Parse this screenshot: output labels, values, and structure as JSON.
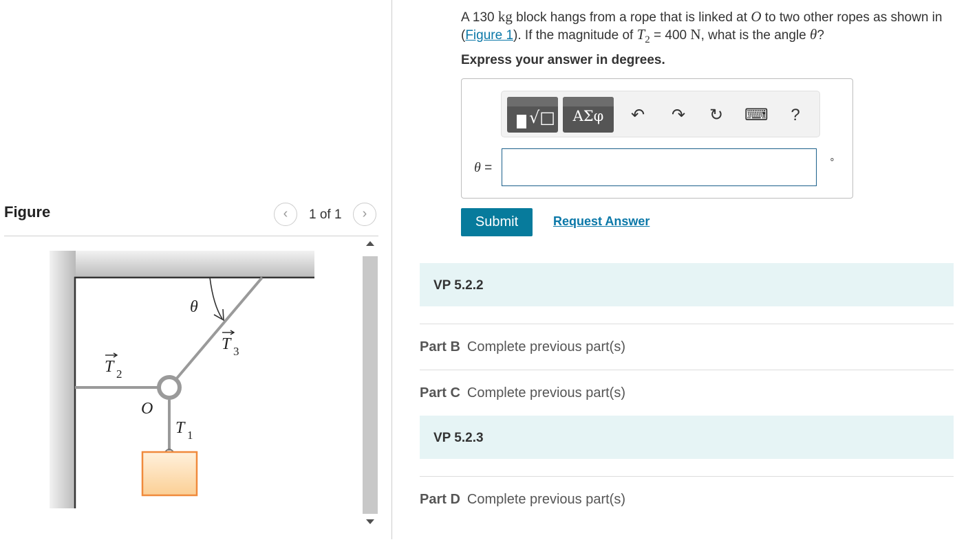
{
  "figure_panel": {
    "title": "Figure",
    "counter": "1 of 1",
    "prev_icon": "chevron-left-icon",
    "next_icon": "chevron-right-icon",
    "labels": {
      "theta": "θ",
      "t3": "T",
      "t3_sub": "3",
      "t2": "T",
      "t2_sub": "2",
      "t1": "T",
      "t1_sub": "1",
      "origin": "O"
    }
  },
  "question": {
    "t_a": "A 130 ",
    "t_kg": "kg",
    "t_b": " block hangs from a rope that is linked at ",
    "t_O": "O",
    "t_c": " to two other ropes as shown in (",
    "figure_link": "Figure 1",
    "t_d": "). If the magnitude of ",
    "t_T": "T",
    "t_T_sub": "2",
    "t_e": " = 400 ",
    "t_N": "N",
    "t_f": ", what is the angle ",
    "t_theta": "θ",
    "t_g": "?"
  },
  "instruction": "Express your answer in degrees.",
  "toolbar": {
    "templates_icon": "templates-icon",
    "symbols_label": "ΑΣφ",
    "undo_icon": "undo-icon",
    "redo_icon": "redo-icon",
    "reset_icon": "reset-icon",
    "keyboard_icon": "keyboard-icon",
    "help_label": "?"
  },
  "answer": {
    "variable": "θ",
    "equals": " =",
    "value": "",
    "unit": "∘"
  },
  "buttons": {
    "submit": "Submit",
    "request_answer": "Request Answer"
  },
  "sections": [
    {
      "label": "VP 5.2.2"
    },
    {
      "label": "VP 5.2.3"
    }
  ],
  "parts": [
    {
      "label": "Part B",
      "status": "Complete previous part(s)"
    },
    {
      "label": "Part C",
      "status": "Complete previous part(s)"
    },
    {
      "label": "Part D",
      "status": "Complete previous part(s)"
    }
  ],
  "colors": {
    "accent": "#077b9c",
    "link": "#0b78a8",
    "vp_band": "#e6f4f5",
    "block_fill": "#fdd9a8",
    "block_stroke": "#f08a3c"
  }
}
